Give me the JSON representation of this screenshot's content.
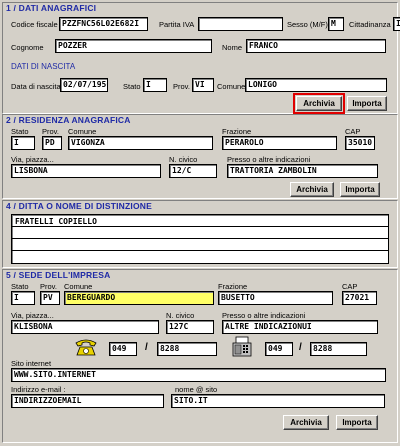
{
  "s1": {
    "title": "1 / DATI ANAGRAFICI",
    "codice_fiscale_label": "Codice fiscale",
    "codice_fiscale": "PZZFNC56L02E682I",
    "partita_iva_label": "Partita IVA",
    "partita_iva": "",
    "sesso_label": "Sesso (M/F)",
    "sesso": "M",
    "cittadinanza_label": "Cittadinanza",
    "cittadinanza": "I",
    "cognome_label": "Cognome",
    "cognome": "POZZER",
    "nome_label": "Nome",
    "nome": "FRANCO",
    "nascita_title": "DATI DI NASCITA",
    "data_label": "Data di nascita",
    "data": "02/07/1956",
    "stato_label": "Stato",
    "stato": "I",
    "prov_label": "Prov.",
    "prov": "VI",
    "comune_label": "Comune",
    "comune": "LONIGO",
    "archivia": "Archivia",
    "importa": "Importa"
  },
  "s2": {
    "title": "2 / RESIDENZA ANAGRAFICA",
    "stato_label": "Stato",
    "stato": "I",
    "prov_label": "Prov.",
    "prov": "PD",
    "comune_label": "Comune",
    "comune": "VIGONZA",
    "frazione_label": "Frazione",
    "frazione": "PERAROLO",
    "cap_label": "CAP",
    "cap": "35010",
    "via_label": "Via, piazza...",
    "via": "LISBONA",
    "civico_label": "N. civico",
    "civico": "12/C",
    "presso_label": "Presso o altre indicazioni",
    "presso": "TRATTORIA ZAMBOLIN",
    "archivia": "Archivia",
    "importa": "Importa"
  },
  "s4": {
    "title": "4 / DITTA O NOME DI DISTINZIONE",
    "ditta": "FRATELLI COPIELLO"
  },
  "s5": {
    "title": "5 / SEDE DELL'IMPRESA",
    "stato_label": "Stato",
    "stato": "I",
    "prov_label": "Prov.",
    "prov": "PV",
    "comune_label": "Comune",
    "comune": "BEREGUARDO",
    "frazione_label": "Frazione",
    "frazione": "BUSETTO",
    "cap_label": "CAP",
    "cap": "27021",
    "via_label": "Via, piazza...",
    "via": "KLISBONA",
    "civico_label": "N. civico",
    "civico": "127C",
    "presso_label": "Presso o altre indicazioni",
    "presso": "ALTRE INDICAZIONUI",
    "tel_prefix": "049",
    "tel_slash": "/",
    "tel_number": "8288",
    "fax_prefix": "049",
    "fax_slash": "/",
    "fax_number": "8288",
    "sito_label": "Sito internet",
    "sito": "WWW.SITO.INTERNET",
    "email_label": "Indirizzo e-mail :",
    "email": "INDIRIZZOEMAIL",
    "nome_sito_label": "nome @ sito",
    "nome_sito": "SITO.IT",
    "archivia": "Archivia",
    "importa": "Importa"
  }
}
